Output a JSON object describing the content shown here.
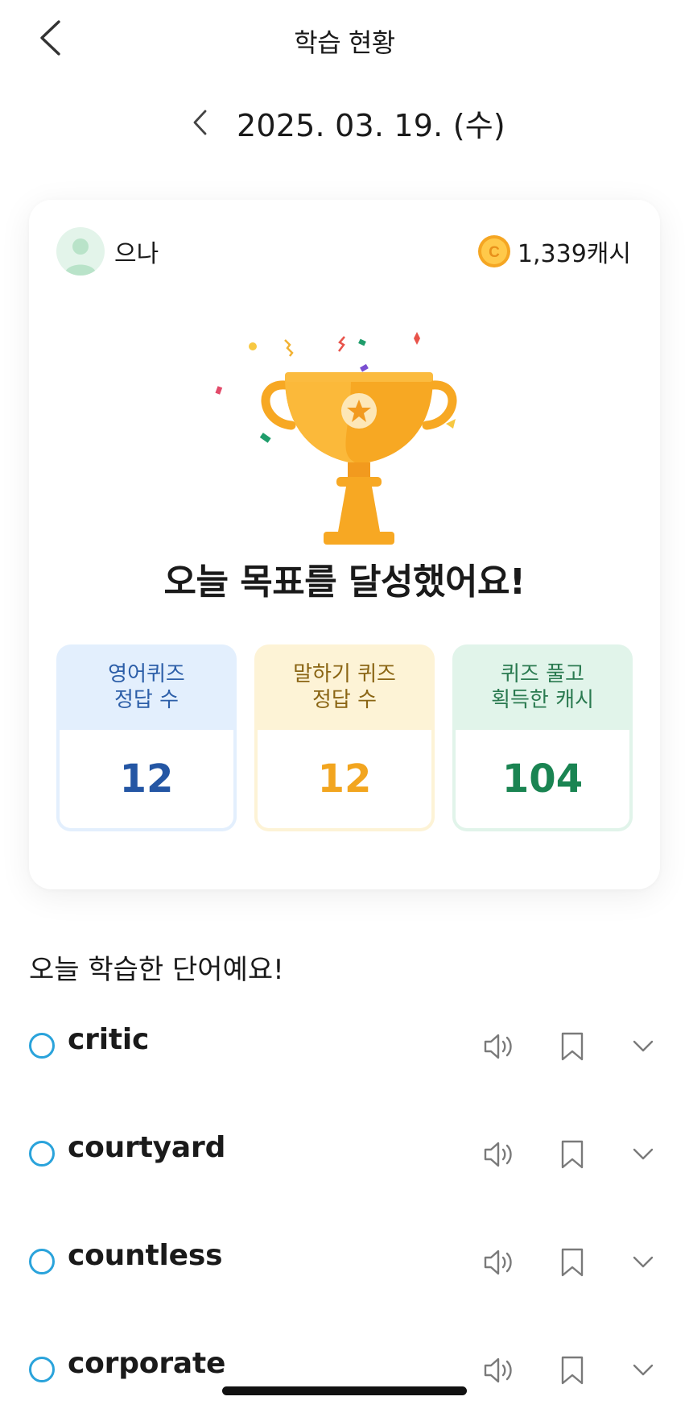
{
  "header": {
    "title": "학습 현황"
  },
  "date": {
    "text": "2025. 03. 19. (수)"
  },
  "card": {
    "username": "으나",
    "cash": "1,339캐시",
    "coin_letter": "C",
    "goal_message": "오늘 목표를 달성했어요!",
    "stats": [
      {
        "title_line1": "영어퀴즈",
        "title_line2": "정답 수",
        "value": "12"
      },
      {
        "title_line1": "말하기 퀴즈",
        "title_line2": "정답 수",
        "value": "12"
      },
      {
        "title_line1": "퀴즈 풀고",
        "title_line2": "획득한 캐시",
        "value": "104"
      }
    ]
  },
  "words": {
    "title": "오늘 학습한 단어예요!",
    "items": [
      {
        "word": "critic"
      },
      {
        "word": "courtyard"
      },
      {
        "word": "countless"
      },
      {
        "word": "corporate"
      }
    ]
  },
  "colors": {
    "check_ring": "#2aa3db",
    "trophy": "#f7a823",
    "blue_stat": "#2456a4",
    "yellow_stat": "#f2a51f",
    "green_stat": "#1a8452"
  },
  "icons": {
    "back": "chevron-left-icon",
    "date_prev": "chevron-left-icon",
    "coin": "coin-icon",
    "trophy": "trophy-icon",
    "sound": "speaker-icon",
    "bookmark": "bookmark-icon",
    "expand": "chevron-down-icon"
  }
}
